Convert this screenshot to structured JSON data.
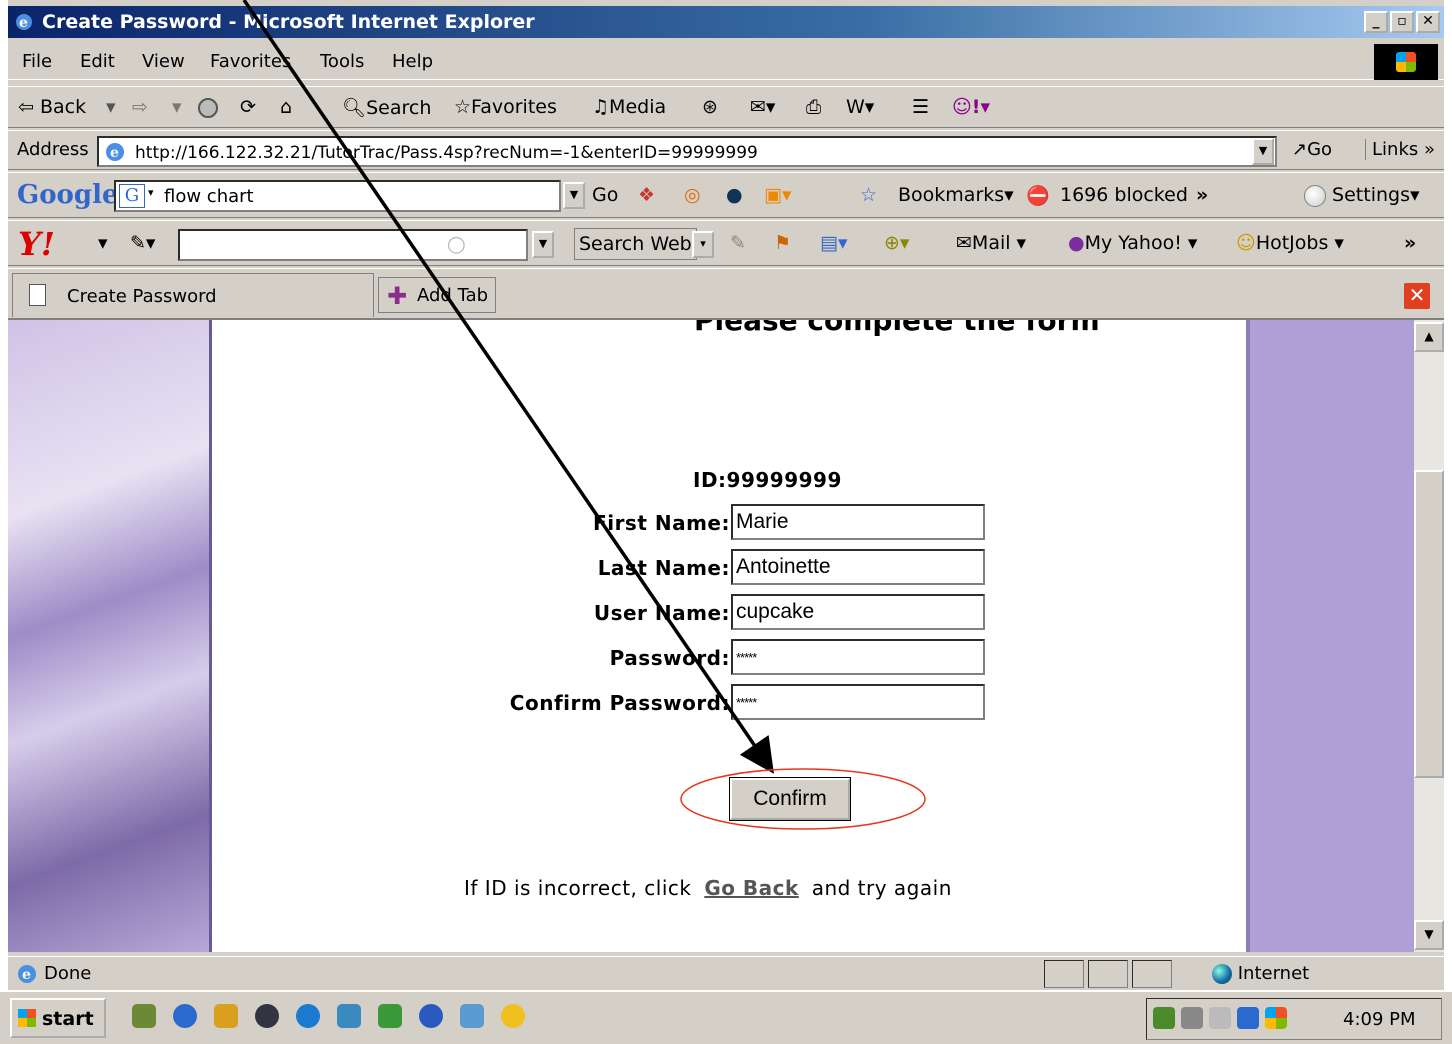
{
  "window": {
    "title": "Create Password - Microsoft Internet Explorer",
    "min_glyph": "_",
    "max_glyph": "▫",
    "close_glyph": "✕"
  },
  "menu": {
    "file": "File",
    "edit": "Edit",
    "view": "View",
    "favorites": "Favorites",
    "tools": "Tools",
    "help": "Help"
  },
  "toolbar": {
    "back": "⇦ Back",
    "search": "Search",
    "favorites": "Favorites",
    "media": "Media"
  },
  "address": {
    "label": "Address",
    "url": "http://166.122.32.21/TutorTrac/Pass.4sp?recNum=-1&enterID=99999999",
    "go": "Go",
    "links": "Links"
  },
  "google_bar": {
    "logo": "Google",
    "query": "flow chart",
    "go": "Go",
    "bookmarks": "Bookmarks",
    "blocked": "1696 blocked",
    "settings": "Settings"
  },
  "yahoo_bar": {
    "logo": "Y!",
    "search_web": "Search Web",
    "mail": "Mail",
    "my_yahoo": "My Yahoo!",
    "hotjobs": "HotJobs"
  },
  "tabs": {
    "current": "Create Password",
    "add": "Add Tab"
  },
  "page": {
    "heading": "Please complete the form",
    "id_label": "ID:99999999",
    "fields": [
      {
        "label": "First Name:",
        "value": "Marie"
      },
      {
        "label": "Last Name:",
        "value": "Antoinette"
      },
      {
        "label": "User Name:",
        "value": "cupcake"
      },
      {
        "label": "Password:",
        "value": "*****"
      },
      {
        "label": "Confirm Password:",
        "value": "*****"
      }
    ],
    "confirm_button": "Confirm",
    "back_prefix": "If ID is incorrect, click",
    "back_link": "Go Back",
    "back_suffix": "and try again"
  },
  "status": {
    "text": "Done",
    "zone": "Internet"
  },
  "taskbar": {
    "start": "start",
    "clock": "4:09 PM"
  },
  "colors": {
    "annotation_arrow": "#000000",
    "annotation_ellipse": "#e8361a",
    "side_panel": "#ae9fd5"
  }
}
